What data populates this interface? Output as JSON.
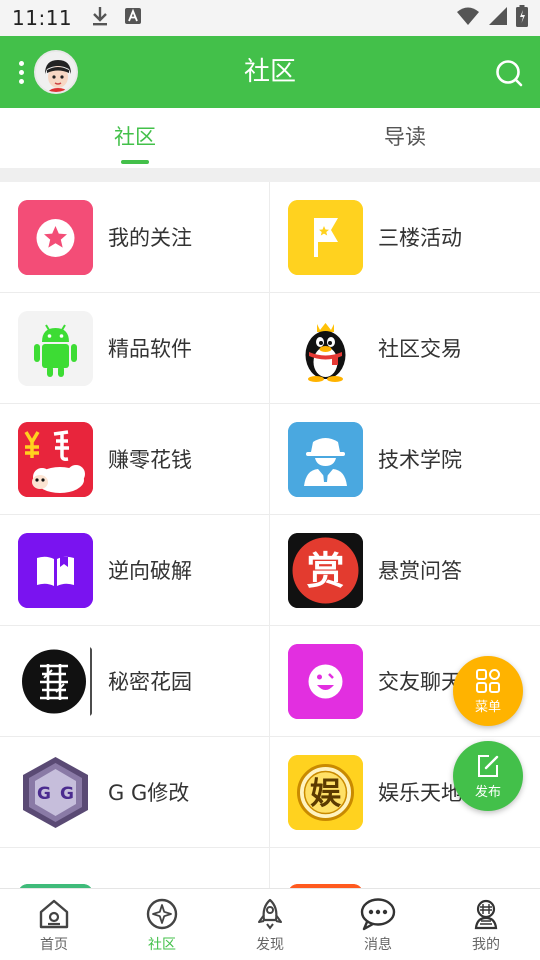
{
  "status_bar": {
    "time": "11:11",
    "icons": [
      "download-icon",
      "a-badge-icon",
      "wifi-icon",
      "signal-icon",
      "battery-icon"
    ]
  },
  "app_bar": {
    "title": "社区",
    "background": "#43c04a",
    "icons": [
      "more-vertical-icon",
      "avatar",
      "search-icon"
    ]
  },
  "top_tabs": [
    {
      "label": "社区",
      "active": true
    },
    {
      "label": "导读",
      "active": false
    }
  ],
  "grid_items": [
    {
      "label": "我的关注",
      "icon": "star-icon",
      "color": "#f2557a"
    },
    {
      "label": "三楼活动",
      "icon": "flag-icon",
      "color": "#ffd21f"
    },
    {
      "label": "精品软件",
      "icon": "android-icon",
      "color": "#f1f1f1"
    },
    {
      "label": "社区交易",
      "icon": "penguin-icon",
      "color": "#ffffff"
    },
    {
      "label": "赚零花钱",
      "icon": "sheep-icon",
      "color": "#e8253c"
    },
    {
      "label": "技术学院",
      "icon": "agent-icon",
      "color": "#4aa8e0"
    },
    {
      "label": "逆向破解",
      "icon": "book-icon",
      "color": "#7a13f0"
    },
    {
      "label": "悬赏问答",
      "icon": "reward-icon",
      "color": "#111111"
    },
    {
      "label": "秘密花园",
      "icon": "emblem-icon",
      "color": "#ffffff"
    },
    {
      "label": "交友聊天",
      "icon": "smile-icon",
      "color": "#e22fe0"
    },
    {
      "label": "G G修改",
      "icon": "gg-icon",
      "color": "#ffffff"
    },
    {
      "label": "娱乐天地",
      "icon": "entertainment-icon",
      "color": "#ffd21f"
    },
    {
      "label": "",
      "icon": "green-partial-icon",
      "color": "#3fbb7a"
    },
    {
      "label": "",
      "icon": "orange-partial-icon",
      "color": "#ff5a1f"
    }
  ],
  "fabs": {
    "menu_label": "菜单",
    "post_label": "发布",
    "menu_color": "#ffb300",
    "post_color": "#43c04a"
  },
  "bottom_nav": [
    {
      "label": "首页",
      "icon": "home-icon",
      "active": false
    },
    {
      "label": "社区",
      "icon": "community-icon",
      "active": true
    },
    {
      "label": "发现",
      "icon": "rocket-icon",
      "active": false
    },
    {
      "label": "消息",
      "icon": "message-icon",
      "active": false
    },
    {
      "label": "我的",
      "icon": "profile-icon",
      "active": false
    }
  ]
}
